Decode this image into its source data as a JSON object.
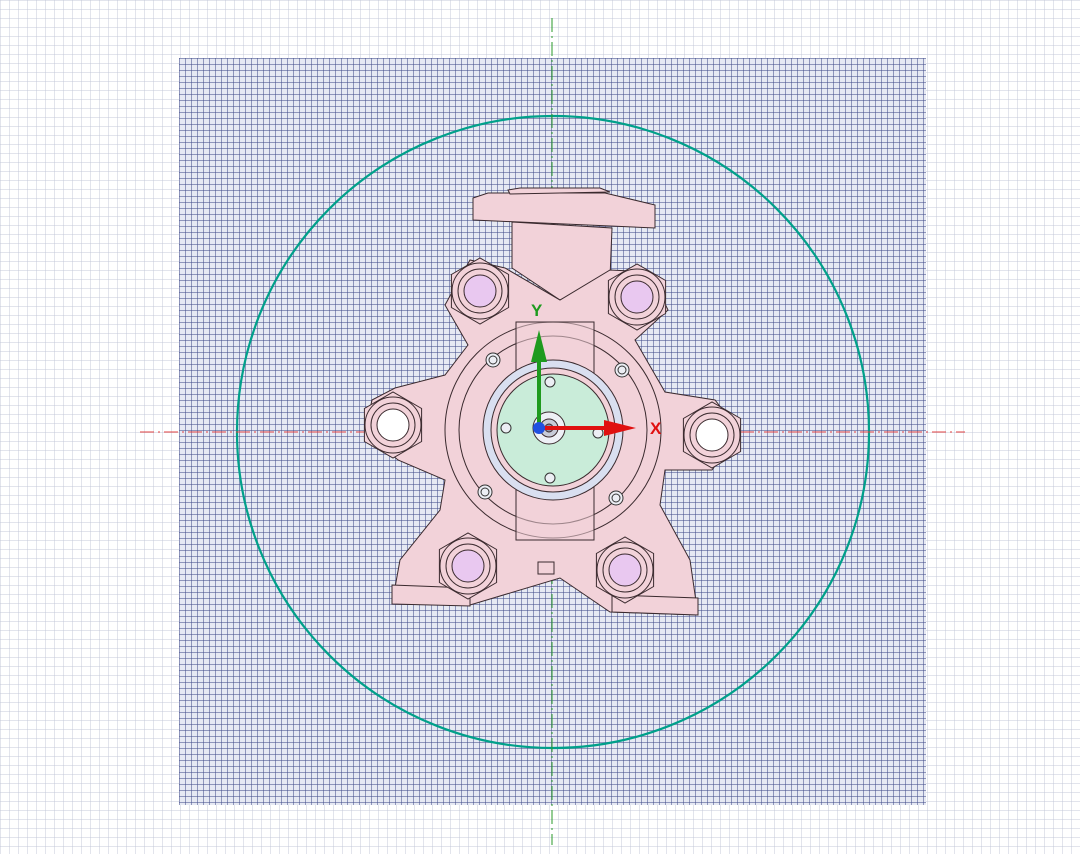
{
  "view": {
    "axis_labels": {
      "x": "X",
      "y": "Y"
    },
    "colors": {
      "part_fill": "#f2d2d9",
      "part_stroke": "#3a2a2e",
      "center_disc": "#c9ecd9",
      "port_fill": "#e9c8f0",
      "boundary_circle": "#00a08a",
      "x_axis": "#e01010",
      "y_axis": "#1e9a1e",
      "z_axis": "#2050e0",
      "centerline_horizontal": "#e04040",
      "centerline_vertical": "#2a9a2a"
    }
  }
}
